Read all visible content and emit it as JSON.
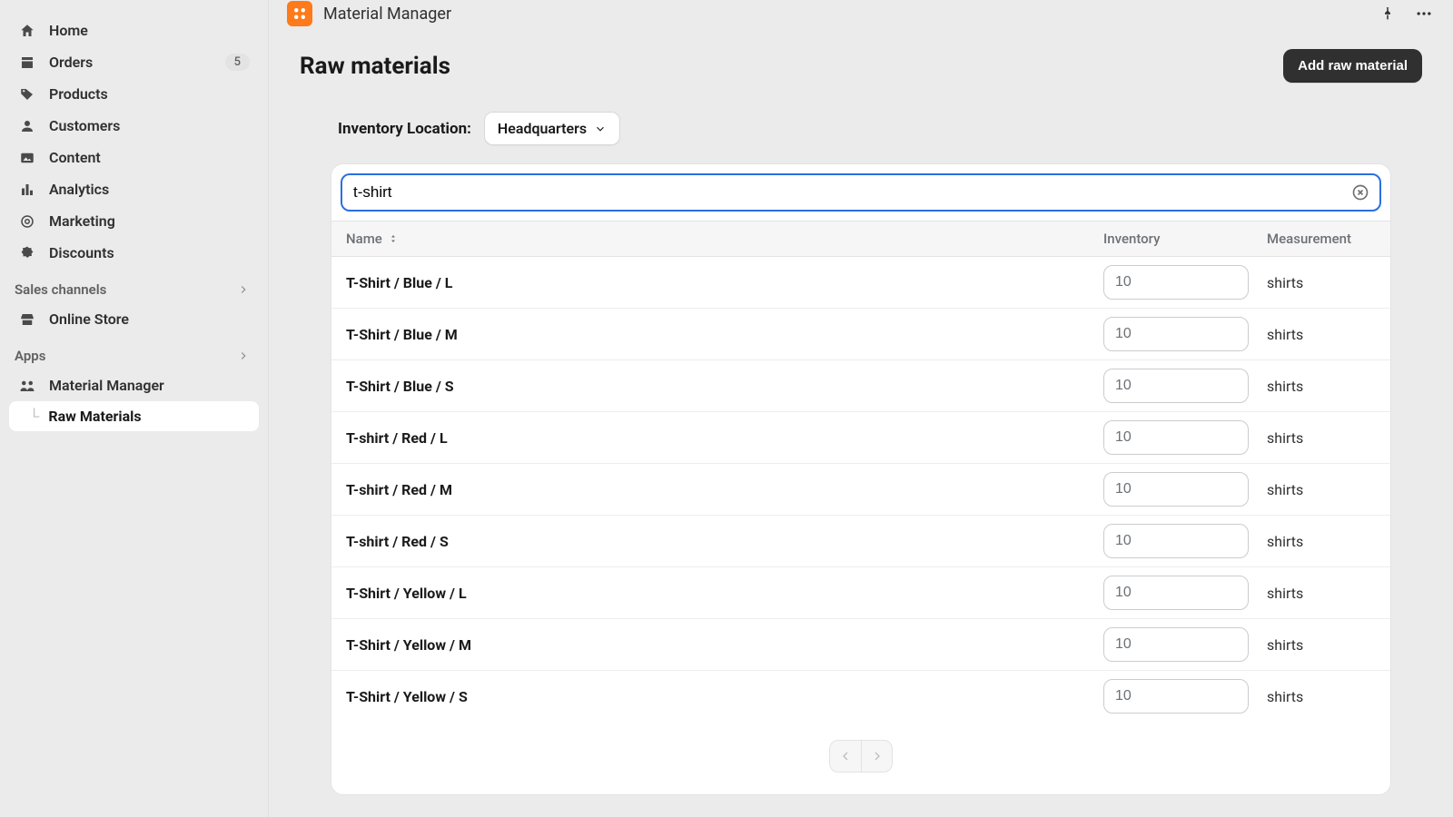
{
  "sidebar": {
    "items": [
      {
        "label": "Home"
      },
      {
        "label": "Orders",
        "badge": "5"
      },
      {
        "label": "Products"
      },
      {
        "label": "Customers"
      },
      {
        "label": "Content"
      },
      {
        "label": "Analytics"
      },
      {
        "label": "Marketing"
      },
      {
        "label": "Discounts"
      }
    ],
    "sales_channels_label": "Sales channels",
    "online_store_label": "Online Store",
    "apps_label": "Apps",
    "material_manager_label": "Material Manager",
    "raw_materials_label": "Raw Materials"
  },
  "header": {
    "app_title": "Material Manager"
  },
  "page": {
    "title": "Raw materials",
    "add_button": "Add raw material",
    "filter_label": "Inventory Location:",
    "location_selected": "Headquarters",
    "search_value": "t-shirt"
  },
  "table": {
    "col_name": "Name",
    "col_inventory": "Inventory",
    "col_measurement": "Measurement",
    "rows": [
      {
        "name": "T-Shirt / Blue / L",
        "inventory": "10",
        "measurement": "shirts"
      },
      {
        "name": "T-Shirt / Blue / M",
        "inventory": "10",
        "measurement": "shirts"
      },
      {
        "name": "T-Shirt / Blue / S",
        "inventory": "10",
        "measurement": "shirts"
      },
      {
        "name": "T-shirt / Red / L",
        "inventory": "10",
        "measurement": "shirts"
      },
      {
        "name": "T-shirt / Red / M",
        "inventory": "10",
        "measurement": "shirts"
      },
      {
        "name": "T-shirt / Red / S",
        "inventory": "10",
        "measurement": "shirts"
      },
      {
        "name": "T-Shirt / Yellow / L",
        "inventory": "10",
        "measurement": "shirts"
      },
      {
        "name": "T-Shirt / Yellow / M",
        "inventory": "10",
        "measurement": "shirts"
      },
      {
        "name": "T-Shirt / Yellow / S",
        "inventory": "10",
        "measurement": "shirts"
      }
    ]
  }
}
